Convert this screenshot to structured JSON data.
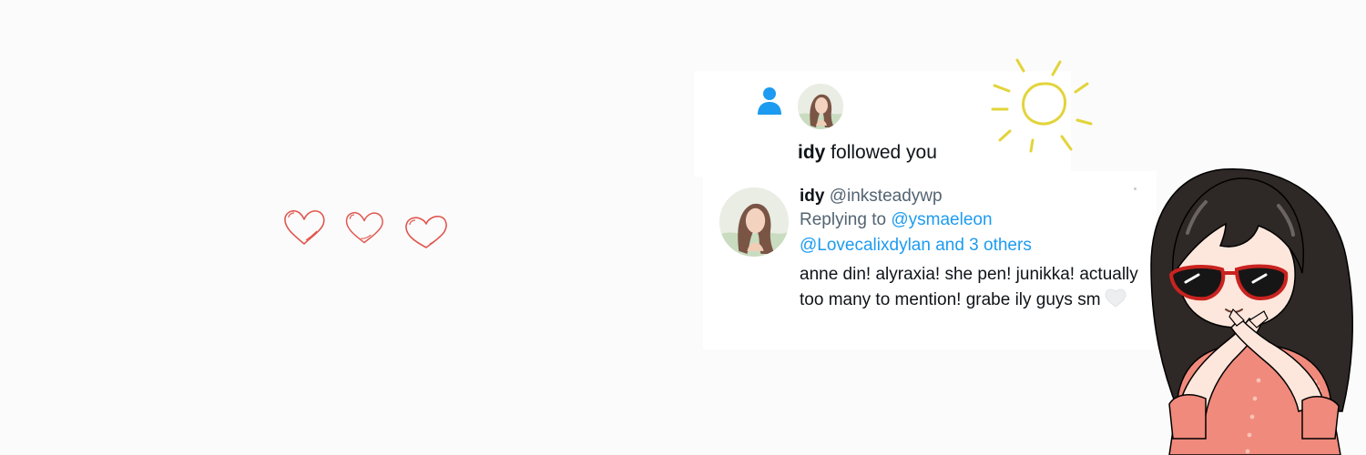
{
  "notification": {
    "name": "idy",
    "action": " followed you"
  },
  "reply": {
    "name": "idy",
    "handle": "@inksteadywp",
    "replying_prefix": "Replying to ",
    "mention_1": "@ysmaeleon",
    "mention_2": "@Lovecalixdylan and 3 others",
    "text": "anne din! alyraxia! she pen! junikka! actually too many to mention! grabe ily guys sm"
  },
  "colors": {
    "background": "#fbfbfb",
    "heart_outline": "#e0574f",
    "link_blue": "#1d9bf0",
    "sun_yellow": "#e2d43a",
    "person_icon": "#1d9bf0"
  },
  "icons": {
    "follow": "person-icon",
    "emoji": "white-heart-emoji",
    "decoration": [
      "heart-doodle",
      "heart-doodle",
      "heart-doodle",
      "sun-doodle"
    ]
  }
}
